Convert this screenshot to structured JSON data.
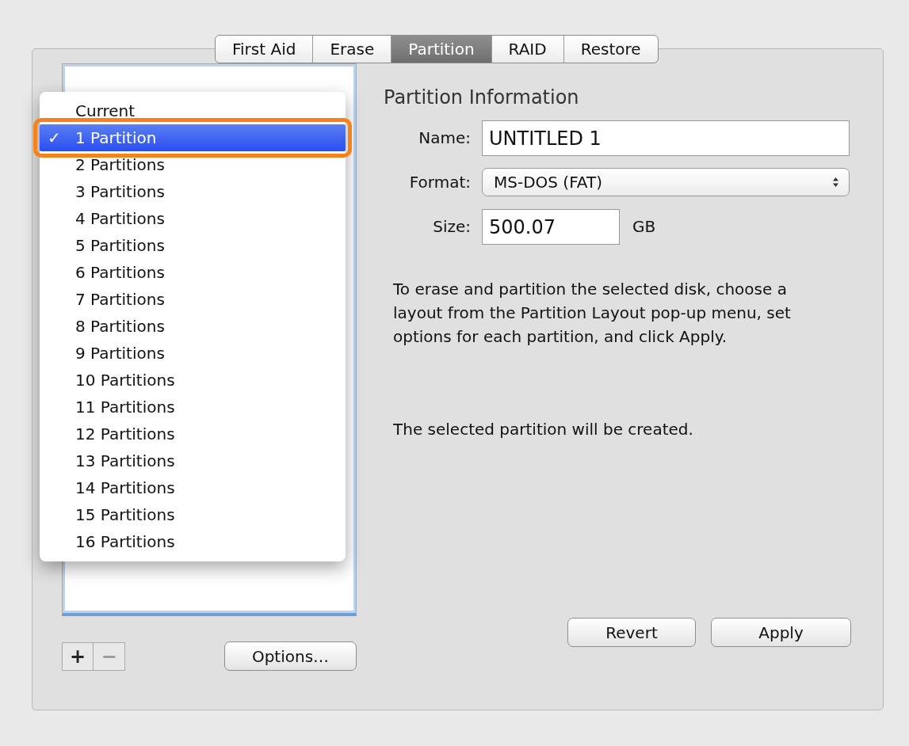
{
  "tabs": [
    {
      "label": "First Aid",
      "selected": false
    },
    {
      "label": "Erase",
      "selected": false
    },
    {
      "label": "Partition",
      "selected": true
    },
    {
      "label": "RAID",
      "selected": false
    },
    {
      "label": "Restore",
      "selected": false
    }
  ],
  "layout_menu": {
    "check_mark": "✓",
    "items": [
      {
        "label": "Current",
        "selected": false
      },
      {
        "label": "1 Partition",
        "selected": true
      },
      {
        "label": "2 Partitions",
        "selected": false
      },
      {
        "label": "3 Partitions",
        "selected": false
      },
      {
        "label": "4 Partitions",
        "selected": false
      },
      {
        "label": "5 Partitions",
        "selected": false
      },
      {
        "label": "6 Partitions",
        "selected": false
      },
      {
        "label": "7 Partitions",
        "selected": false
      },
      {
        "label": "8 Partitions",
        "selected": false
      },
      {
        "label": "9 Partitions",
        "selected": false
      },
      {
        "label": "10 Partitions",
        "selected": false
      },
      {
        "label": "11 Partitions",
        "selected": false
      },
      {
        "label": "12 Partitions",
        "selected": false
      },
      {
        "label": "13 Partitions",
        "selected": false
      },
      {
        "label": "14 Partitions",
        "selected": false
      },
      {
        "label": "15 Partitions",
        "selected": false
      },
      {
        "label": "16 Partitions",
        "selected": false
      }
    ]
  },
  "list_buttons": {
    "add": "+",
    "remove": "−"
  },
  "options_button": "Options…",
  "partition_information": {
    "title": "Partition Information",
    "name": {
      "label": "Name:",
      "value": "UNTITLED 1"
    },
    "format": {
      "label": "Format:",
      "value": "MS-DOS (FAT)"
    },
    "size": {
      "label": "Size:",
      "value": "500.07",
      "unit": "GB"
    },
    "instructions": "To erase and partition the selected disk, choose a layout from the Partition Layout pop-up menu, set options for each partition, and click Apply.",
    "status": "The selected partition will be created."
  },
  "buttons": {
    "revert": "Revert",
    "apply": "Apply"
  }
}
